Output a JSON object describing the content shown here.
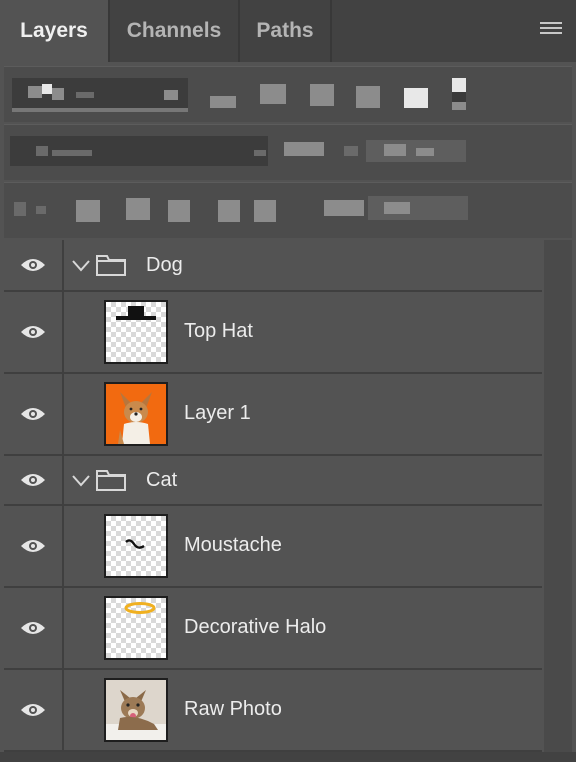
{
  "tabs": [
    {
      "label": "Layers",
      "active": true
    },
    {
      "label": "Channels",
      "active": false
    },
    {
      "label": "Paths",
      "active": false
    }
  ],
  "panel_menu_icon": "hamburger-menu-icon",
  "layers": [
    {
      "type": "group",
      "name": "Dog",
      "expanded": true,
      "visible": true
    },
    {
      "type": "layer",
      "name": "Top Hat",
      "visible": true,
      "thumbnail": "top-hat"
    },
    {
      "type": "layer",
      "name": "Layer 1",
      "visible": true,
      "thumbnail": "dog-photo"
    },
    {
      "type": "group",
      "name": "Cat",
      "expanded": true,
      "visible": true
    },
    {
      "type": "layer",
      "name": "Moustache",
      "visible": true,
      "thumbnail": "moustache"
    },
    {
      "type": "layer",
      "name": "Decorative Halo",
      "visible": true,
      "thumbnail": "halo"
    },
    {
      "type": "layer",
      "name": "Raw Photo",
      "visible": true,
      "thumbnail": "cat-photo"
    }
  ],
  "colors": {
    "panel_bg": "#535353",
    "tabbar_bg": "#424242",
    "divider": "#3f3f3f",
    "dog_photo_bg": "#f26a10",
    "halo": "#f0b020"
  }
}
